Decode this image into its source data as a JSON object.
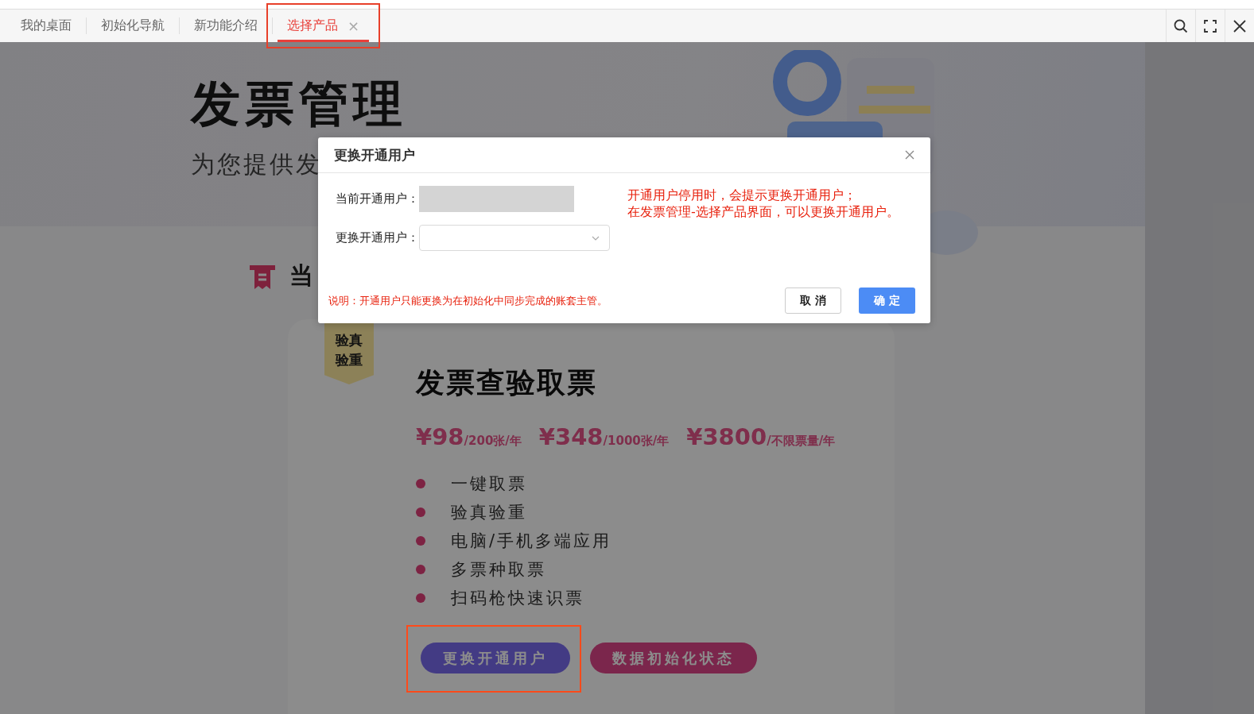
{
  "tabs": [
    {
      "label": "我的桌面",
      "selected": false,
      "highlighted": false
    },
    {
      "label": "初始化导航",
      "selected": false,
      "highlighted": false
    },
    {
      "label": "新功能介绍",
      "selected": false,
      "highlighted": false
    },
    {
      "label": "选择产品",
      "selected": true,
      "close_label": "×",
      "highlighted": true
    }
  ],
  "banner": {
    "title": "发票管理",
    "subtitle": "为您提供发"
  },
  "section_title": "当",
  "card": {
    "badge": [
      "验真",
      "验重"
    ],
    "title": "发票查验取票",
    "prices": [
      {
        "amount": "¥98",
        "unit": "/200张/年"
      },
      {
        "amount": "¥348",
        "unit": "/1000张/年"
      },
      {
        "amount": "¥3800",
        "unit": "/不限票量/年"
      }
    ],
    "features": [
      "一键取票",
      "验真验重",
      "电脑/手机多端应用",
      "多票种取票",
      "扫码枪快速识票"
    ],
    "buttons": [
      {
        "label": "更换开通用户",
        "kind": "primary",
        "highlighted": true
      },
      {
        "label": "数据初始化状态",
        "kind": "secondary",
        "highlighted": false
      }
    ]
  },
  "dialog": {
    "title": "更换开通用户",
    "fields": [
      {
        "label": "当前开通用户：",
        "kind": "readonly"
      },
      {
        "label": "更换开通用户：",
        "kind": "select"
      }
    ],
    "notes": [
      "开通用户停用时，会提示更换开通用户；",
      "在发票管理-选择产品界面，可以更换开通用户。"
    ],
    "footnote": "说明：开通用户只能更换为在初始化中同步完成的账套主管。",
    "cancel": "取 消",
    "confirm": "确 定"
  }
}
